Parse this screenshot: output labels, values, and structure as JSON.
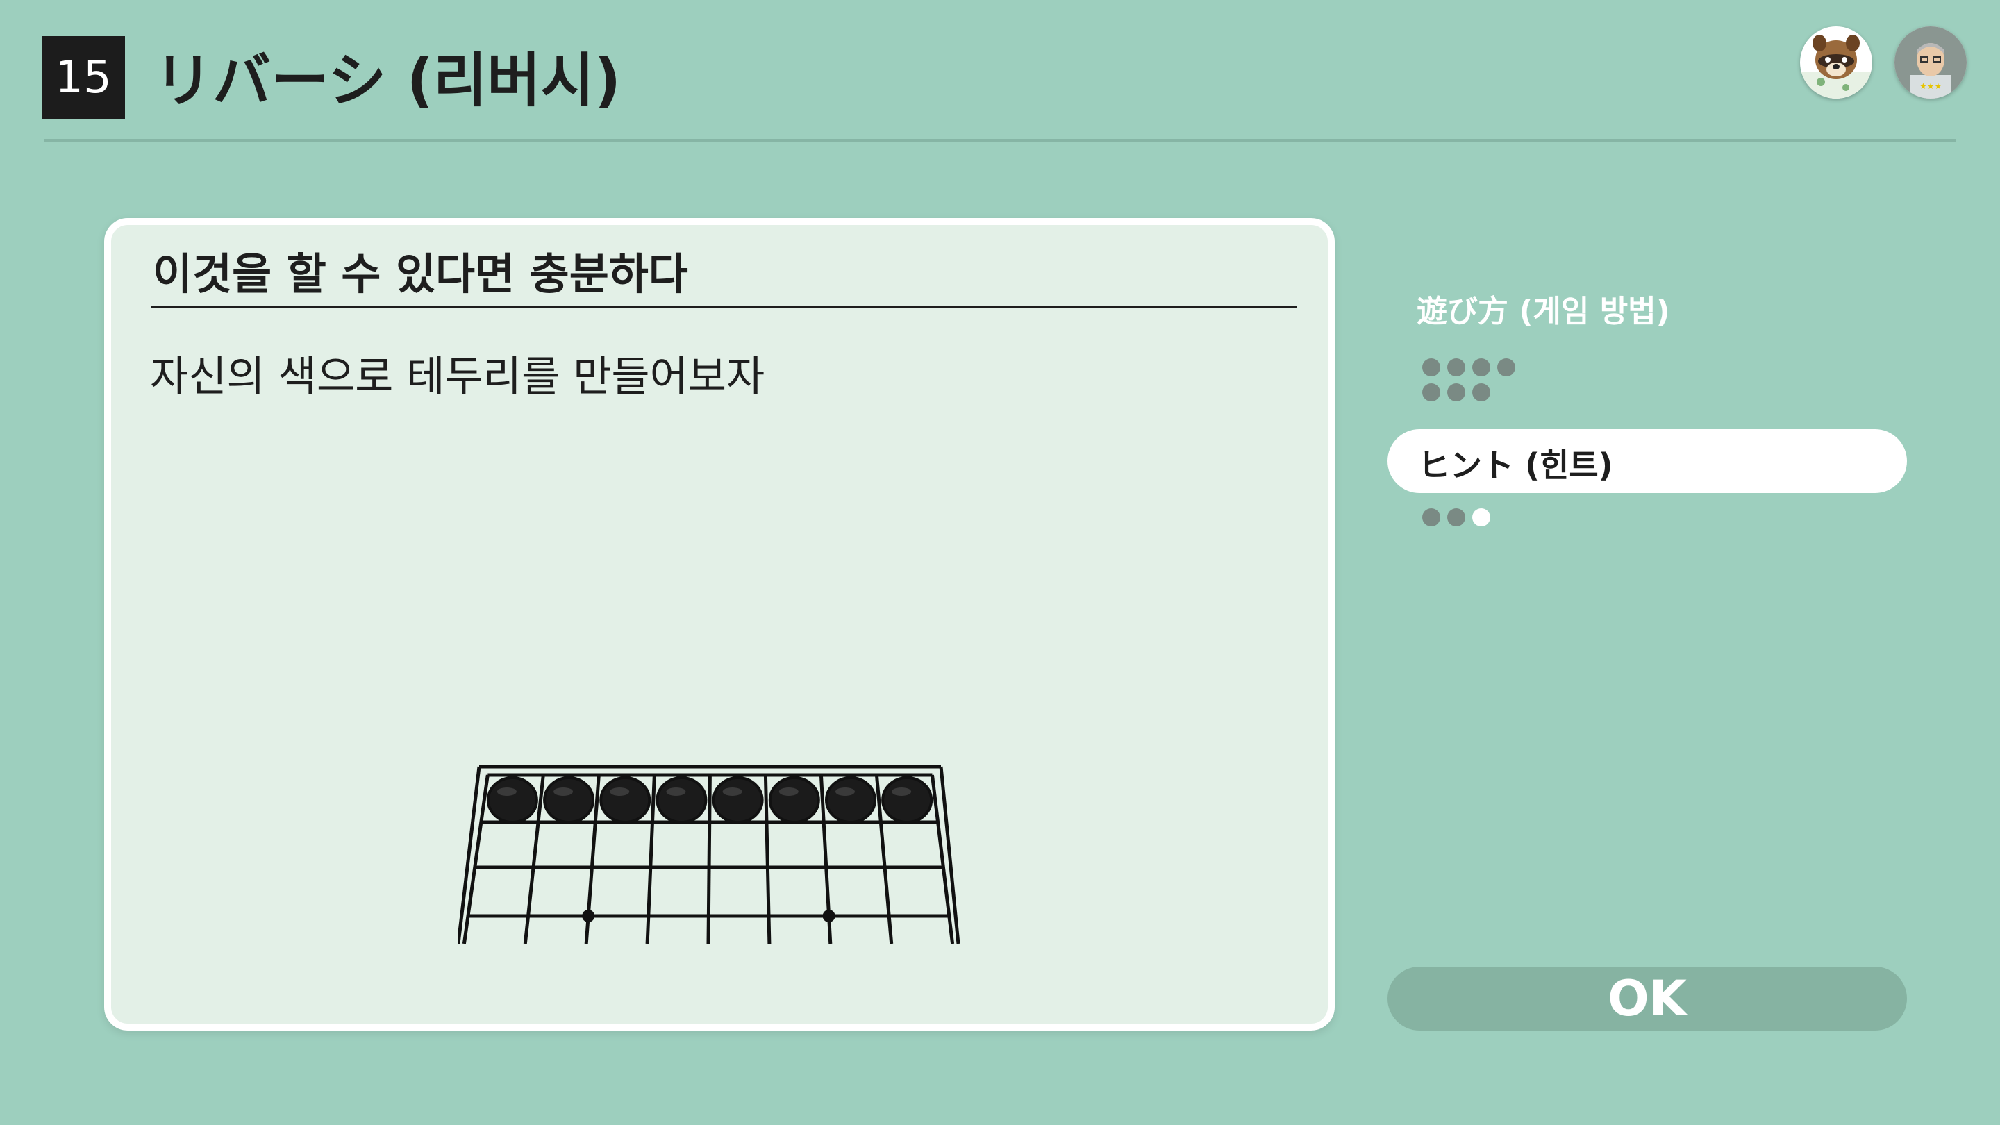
{
  "header": {
    "number": "15",
    "title": "リバーシ (리버시)"
  },
  "avatars": [
    {
      "icon": "raccoon-avatar-icon"
    },
    {
      "icon": "old-man-avatar-icon"
    }
  ],
  "card": {
    "heading": "이것을 할 수 있다면 충분하다",
    "description": "자신의 색으로 테두리를 만들어보자"
  },
  "board": {
    "columns": 8,
    "visible_rows": 4,
    "top_row_stones": [
      "black",
      "black",
      "black",
      "black",
      "black",
      "black",
      "black",
      "black"
    ]
  },
  "side": {
    "play_label": "遊び方 (게임 방법)",
    "play_dots_row1": 4,
    "play_dots_row2": 3,
    "hint_label": "ヒント (힌트)",
    "hint_dots": [
      "gray",
      "gray",
      "white"
    ],
    "ok_label": "OK"
  },
  "colors": {
    "background": "#9dcfbe",
    "card": "#e3f0e7",
    "dot": "#7a8a84",
    "ok_button": "#86b3a2"
  }
}
